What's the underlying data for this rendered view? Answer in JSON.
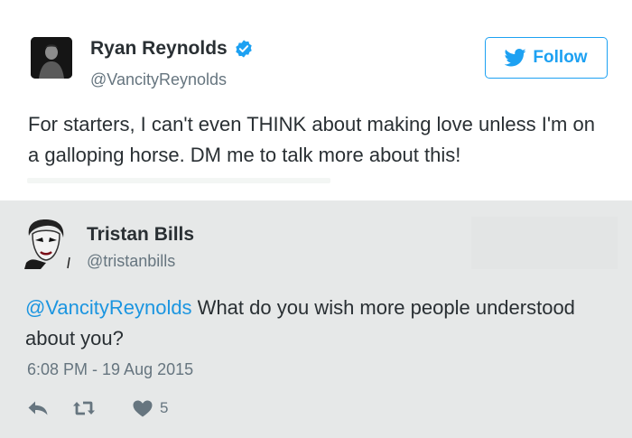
{
  "reply_tweet": {
    "author_name": "Ryan Reynolds",
    "author_handle": "@VancityReynolds",
    "follow_label": "Follow",
    "text": "For starters, I can't even THINK about making love unless I'm on a galloping horse. DM me to talk more about this!"
  },
  "parent_tweet": {
    "author_name": "Tristan Bills",
    "author_handle": "@tristanbills",
    "mention": "@VancityReynolds",
    "text_rest": " What do you wish more people understood about you?",
    "timestamp": "6:08 PM - 19 Aug 2015",
    "like_count": "5"
  },
  "icons": [
    "verified-badge-icon",
    "twitter-bird-icon",
    "reply-icon",
    "retweet-icon",
    "heart-icon"
  ],
  "colors": {
    "twitter_blue": "#1da1f2",
    "mention_blue": "#1b95e0",
    "secondary_text": "#66757f",
    "primary_text": "#292f33",
    "action_icon": "#66757f",
    "parent_background": "#e6e8e8"
  }
}
